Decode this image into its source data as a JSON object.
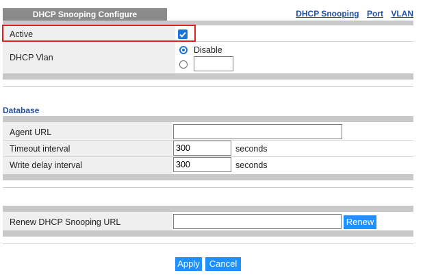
{
  "header": {
    "tab_title": "DHCP Snooping Configure",
    "links": [
      "DHCP Snooping",
      "Port",
      "VLAN"
    ]
  },
  "config": {
    "active_label": "Active",
    "active_checked": true,
    "dhcp_vlan_label": "DHCP Vlan",
    "disable_label": "Disable",
    "vlan_value": ""
  },
  "database": {
    "title": "Database",
    "agent_url_label": "Agent URL",
    "agent_url_value": "",
    "timeout_label": "Timeout interval",
    "timeout_value": "300",
    "timeout_unit": "seconds",
    "write_delay_label": "Write delay interval",
    "write_delay_value": "300",
    "write_delay_unit": "seconds"
  },
  "renew": {
    "label": "Renew DHCP Snooping URL",
    "url_value": "",
    "button_label": "Renew"
  },
  "actions": {
    "apply_label": "Apply",
    "cancel_label": "Cancel"
  },
  "colors": {
    "link": "#1f4fa8",
    "button": "#1e90ff",
    "highlight": "#e02020",
    "checkbox": "#1a73d9"
  }
}
